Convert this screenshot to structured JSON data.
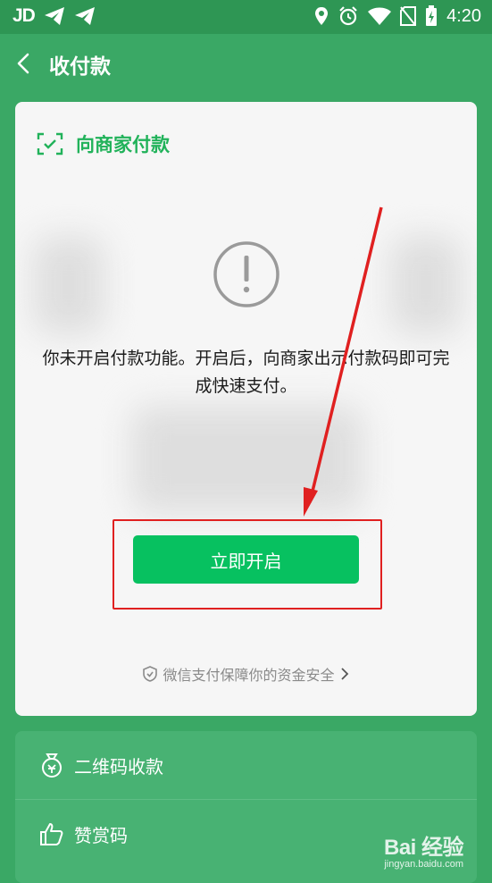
{
  "status_bar": {
    "carrier_text": "JD",
    "time": "4:20",
    "icons": [
      "telegram-icon",
      "telegram-icon",
      "location-icon",
      "alarm-icon",
      "wifi-icon",
      "no-sim-icon",
      "battery-charging-icon"
    ]
  },
  "header": {
    "title": "收付款"
  },
  "pay_card": {
    "title": "向商家付款",
    "message": "你未开启付款功能。开启后，向商家出示付款码即可完成快速支付。",
    "enable_button": "立即开启",
    "security_text": "微信支付保障你的资金安全"
  },
  "list": {
    "items": [
      {
        "label": "二维码收款",
        "icon": "money-bag-icon"
      },
      {
        "label": "赞赏码",
        "icon": "thumbs-up-icon"
      }
    ]
  },
  "watermark": {
    "logo_text": "Bai 经验",
    "url": "jingyan.baidu.com"
  },
  "colors": {
    "header_green": "#3aa865",
    "button_green": "#07c160",
    "accent_text_green": "#21b25a",
    "annotation_red": "#e02020"
  }
}
